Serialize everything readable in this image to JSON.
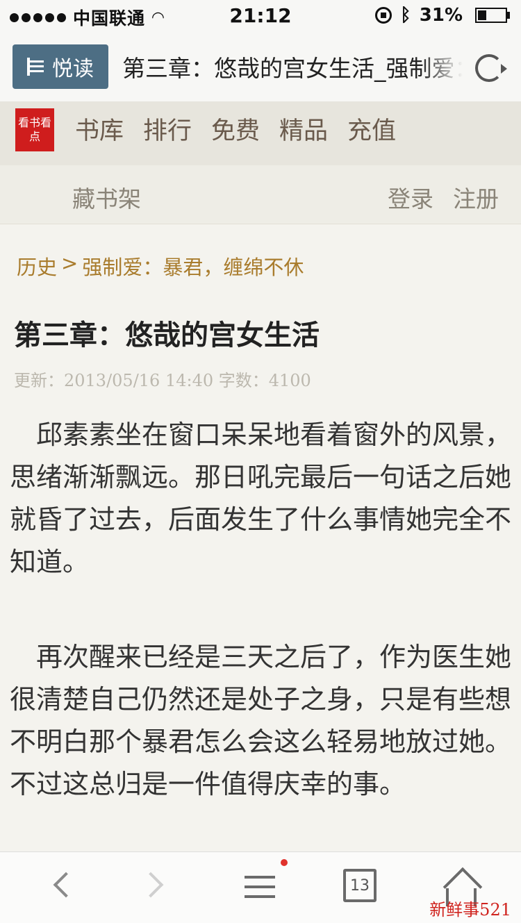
{
  "status_bar": {
    "carrier": "中国联通",
    "time": "21:12",
    "battery": "31%",
    "battery_level": 0.31
  },
  "browser": {
    "reader_button_label": "悦读",
    "page_title": "第三章：悠哉的宫女生活_强制爱：暴君，缠绵不休"
  },
  "site_nav": {
    "logo_text": "看书看点",
    "items": [
      "书库",
      "排行",
      "免费",
      "精品",
      "充值"
    ]
  },
  "sub_bar": {
    "bookshelf": "藏书架",
    "login": "登录",
    "register": "注册"
  },
  "content": {
    "breadcrumb": {
      "category": "历史",
      "separator": ">",
      "book": "强制爱：暴君，缠绵不休"
    },
    "chapter_title": "第三章：悠哉的宫女生活",
    "meta": "更新：2013/05/16 14:40 字数：4100",
    "paragraphs": [
      "邱素素坐在窗口呆呆地看着窗外的风景，思绪渐渐飘远。那日吼完最后一句话之后她就昏了过去，后面发生了什么事情她完全不知道。",
      "再次醒来已经是三天之后了，作为医生她很清楚自己仍然还是处子之身，只是有些想不明白那个暴君怎么会这么轻易地放过她。不过这总归是一件值得庆幸的事。"
    ]
  },
  "toolbar": {
    "tabs_count": "13",
    "icons": [
      "back-icon",
      "forward-icon",
      "menu-icon",
      "tabs-icon",
      "home-icon"
    ]
  },
  "watermark": "新鲜事521"
}
